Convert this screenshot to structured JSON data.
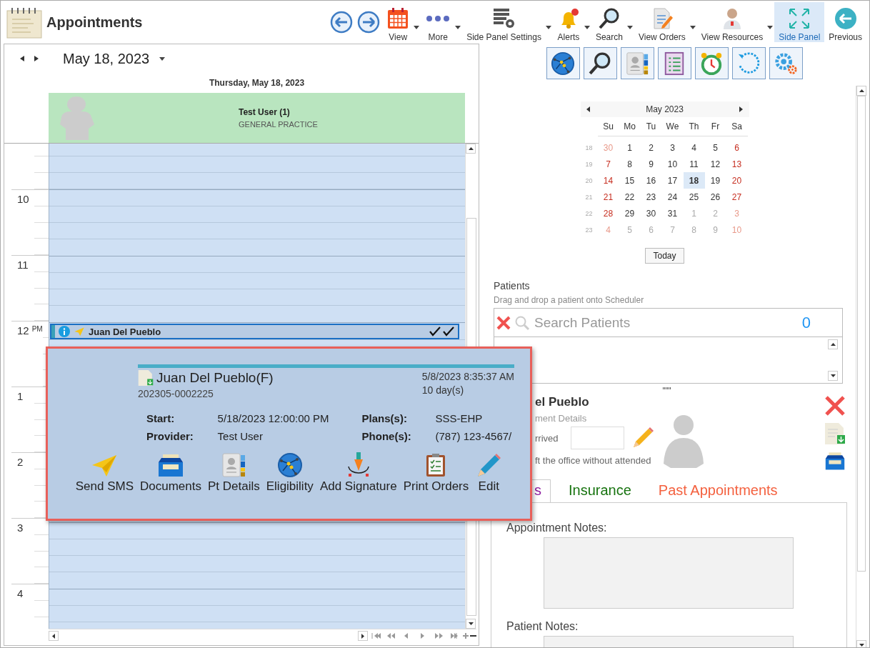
{
  "window": {
    "title": "Appointments"
  },
  "toolbar": [
    {
      "label": "View",
      "dropdown": true,
      "selected": false
    },
    {
      "label": "More",
      "dropdown": true,
      "selected": false
    },
    {
      "label": "Side Panel Settings",
      "dropdown": true,
      "selected": false
    },
    {
      "label": "Alerts",
      "dropdown": true,
      "selected": false
    },
    {
      "label": "Search",
      "dropdown": true,
      "selected": false
    },
    {
      "label": "View Orders",
      "dropdown": true,
      "selected": false
    },
    {
      "label": "View Resources",
      "dropdown": true,
      "selected": false
    },
    {
      "label": "Side Panel",
      "dropdown": false,
      "selected": true
    },
    {
      "label": "Previous",
      "dropdown": false,
      "selected": false
    }
  ],
  "scheduler": {
    "date": "May 18, 2023",
    "day_header": "Thursday, May 18, 2023",
    "resource": {
      "name": "Test User (1)",
      "specialty": "GENERAL PRACTICE"
    },
    "hours": [
      {
        "label": "10"
      },
      {
        "label": "11"
      },
      {
        "label": "12",
        "suffix": "PM",
        "appointments": [
          {
            "patient": "Juan Del Pueblo",
            "selected": true
          }
        ]
      },
      {
        "label": "1"
      },
      {
        "label": "2"
      },
      {
        "label": "3"
      },
      {
        "label": "4"
      }
    ]
  },
  "popup": {
    "patient": "Juan Del Pueblo(F)",
    "record": "202305-0002225",
    "created": "5/8/2023 8:35:37 AM",
    "age": "10 day(s)",
    "fields": [
      {
        "label": "Start:",
        "value": "5/18/2023 12:00:00 PM"
      },
      {
        "label": "Plans(s):",
        "value": "SSS-EHP"
      },
      {
        "label": "Provider:",
        "value": "Test User"
      },
      {
        "label": "Phone(s):",
        "value": "(787) 123-4567/"
      }
    ],
    "actions": [
      "Send SMS",
      "Documents",
      "Pt Details",
      "Eligibility",
      "Add Signature",
      "Print Orders",
      "Edit"
    ]
  },
  "mini_calendar": {
    "title": "May 2023",
    "weekdays": [
      "Su",
      "Mo",
      "Tu",
      "We",
      "Th",
      "Fr",
      "Sa"
    ],
    "weeks": [
      {
        "number": "18",
        "days": [
          {
            "day": "30",
            "other_month": true,
            "selected": false
          },
          {
            "day": "1",
            "other_month": false,
            "selected": false
          },
          {
            "day": "2",
            "other_month": false,
            "selected": false
          },
          {
            "day": "3",
            "other_month": false,
            "selected": false
          },
          {
            "day": "4",
            "other_month": false,
            "selected": false
          },
          {
            "day": "5",
            "other_month": false,
            "selected": false
          },
          {
            "day": "6",
            "other_month": false,
            "selected": false
          }
        ]
      },
      {
        "number": "19",
        "days": [
          {
            "day": "7",
            "other_month": false,
            "selected": false
          },
          {
            "day": "8",
            "other_month": false,
            "selected": false
          },
          {
            "day": "9",
            "other_month": false,
            "selected": false
          },
          {
            "day": "10",
            "other_month": false,
            "selected": false
          },
          {
            "day": "11",
            "other_month": false,
            "selected": false
          },
          {
            "day": "12",
            "other_month": false,
            "selected": false
          },
          {
            "day": "13",
            "other_month": false,
            "selected": false
          }
        ]
      },
      {
        "number": "20",
        "days": [
          {
            "day": "14",
            "other_month": false,
            "selected": false
          },
          {
            "day": "15",
            "other_month": false,
            "selected": false
          },
          {
            "day": "16",
            "other_month": false,
            "selected": false
          },
          {
            "day": "17",
            "other_month": false,
            "selected": false
          },
          {
            "day": "18",
            "other_month": false,
            "selected": true
          },
          {
            "day": "19",
            "other_month": false,
            "selected": false
          },
          {
            "day": "20",
            "other_month": false,
            "selected": false
          }
        ]
      },
      {
        "number": "21",
        "days": [
          {
            "day": "21",
            "other_month": false,
            "selected": false
          },
          {
            "day": "22",
            "other_month": false,
            "selected": false
          },
          {
            "day": "23",
            "other_month": false,
            "selected": false
          },
          {
            "day": "24",
            "other_month": false,
            "selected": false
          },
          {
            "day": "25",
            "other_month": false,
            "selected": false
          },
          {
            "day": "26",
            "other_month": false,
            "selected": false
          },
          {
            "day": "27",
            "other_month": false,
            "selected": false
          }
        ]
      },
      {
        "number": "22",
        "days": [
          {
            "day": "28",
            "other_month": false,
            "selected": false
          },
          {
            "day": "29",
            "other_month": false,
            "selected": false
          },
          {
            "day": "30",
            "other_month": false,
            "selected": false
          },
          {
            "day": "31",
            "other_month": false,
            "selected": false
          },
          {
            "day": "1",
            "other_month": true,
            "selected": false
          },
          {
            "day": "2",
            "other_month": true,
            "selected": false
          },
          {
            "day": "3",
            "other_month": true,
            "selected": false
          }
        ]
      },
      {
        "number": "23",
        "days": [
          {
            "day": "4",
            "other_month": true,
            "selected": false
          },
          {
            "day": "5",
            "other_month": true,
            "selected": false
          },
          {
            "day": "6",
            "other_month": true,
            "selected": false
          },
          {
            "day": "7",
            "other_month": true,
            "selected": false
          },
          {
            "day": "8",
            "other_month": true,
            "selected": false
          },
          {
            "day": "9",
            "other_month": true,
            "selected": false
          },
          {
            "day": "10",
            "other_month": true,
            "selected": false
          }
        ]
      }
    ],
    "today_button": "Today"
  },
  "patients": {
    "title": "Patients",
    "hint": "Drag and drop a patient onto Scheduler",
    "search": {
      "placeholder": "Search Patients"
    },
    "count": "0"
  },
  "details": {
    "name": "el Pueblo",
    "subtitle": "ment Details",
    "arrived_label": "rrived",
    "left_office": "ft the office without attended",
    "tabs": [
      {
        "label": "s",
        "selected": true,
        "color": "#8e1fa0"
      },
      {
        "label": "Insurance",
        "selected": false,
        "color": "#17730f"
      },
      {
        "label": "Past Appointments",
        "selected": false,
        "color": "#f4613f"
      }
    ],
    "appointment_notes_label": "Appointment Notes:",
    "patient_notes_label": "Patient Notes:"
  }
}
